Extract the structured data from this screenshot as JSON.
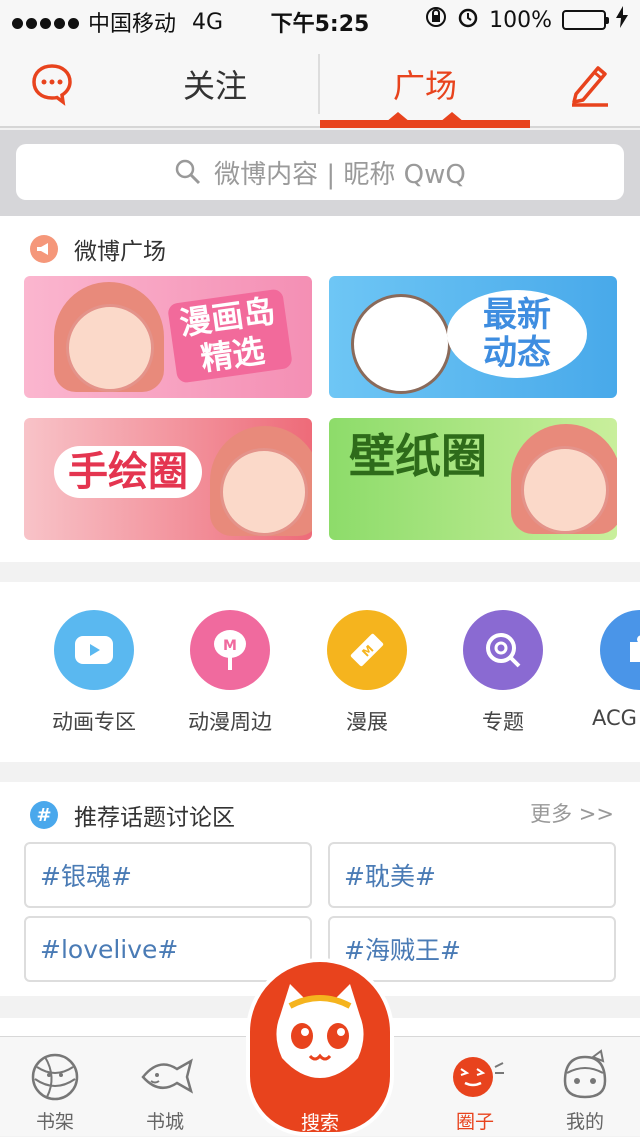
{
  "status_bar": {
    "carrier": "中国移动",
    "network": "4G",
    "time": "下午5:25",
    "battery": "100%"
  },
  "nav": {
    "tabs": [
      {
        "label": "关注",
        "active": false
      },
      {
        "label": "广场",
        "active": true
      }
    ]
  },
  "search": {
    "placeholder": "微博内容 | 昵称 QwQ"
  },
  "plaza": {
    "title": "微博广场",
    "banners": [
      {
        "text": "漫画岛\n精选"
      },
      {
        "text": "最新\n动态"
      },
      {
        "text": "手绘圈"
      },
      {
        "text": "壁纸圈"
      }
    ]
  },
  "categories": [
    {
      "label": "动画专区",
      "icon": "play-icon",
      "color": "#5ab8f0"
    },
    {
      "label": "动漫周边",
      "icon": "fan-icon",
      "color": "#f06a9e"
    },
    {
      "label": "漫展",
      "icon": "ticket-icon",
      "color": "#f5b41e"
    },
    {
      "label": "专题",
      "icon": "lollipop-icon",
      "color": "#8a6ad2"
    },
    {
      "label": "ACG",
      "icon": "puzzle-icon",
      "color": "#4a95e8"
    }
  ],
  "topics": {
    "title": "推荐话题讨论区",
    "more": "更多 >>",
    "items": [
      "#银魂#",
      "#耽美#",
      "#lovelive#",
      "#海贼王#"
    ]
  },
  "tabbar": {
    "items": [
      {
        "label": "书架"
      },
      {
        "label": "书城"
      },
      {
        "label": "搜索"
      },
      {
        "label": "圈子"
      },
      {
        "label": "我的"
      }
    ]
  },
  "colors": {
    "accent": "#e8431d",
    "link": "#4a7bb5"
  }
}
